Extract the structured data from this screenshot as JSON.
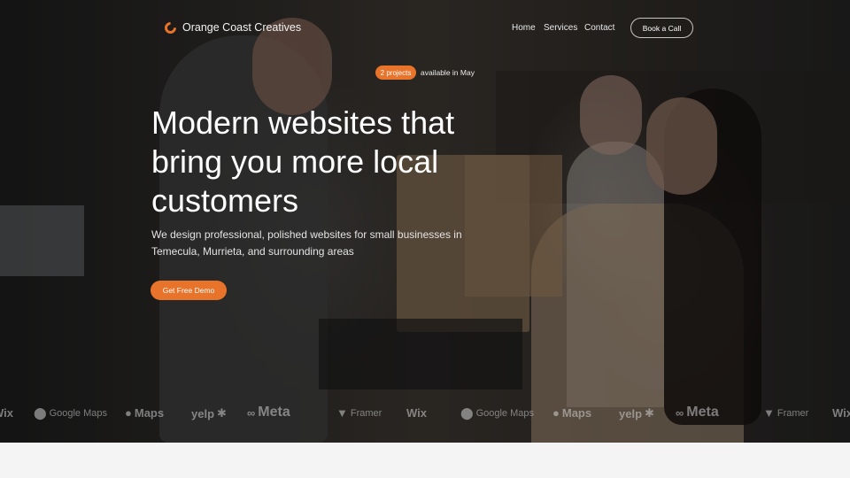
{
  "brand": {
    "name": "Orange Coast Creatives",
    "accent": "#e8732a"
  },
  "nav": {
    "items": [
      {
        "label": "Home"
      },
      {
        "label": "Services"
      },
      {
        "label": "Contact"
      }
    ],
    "cta_label": "Book a Call"
  },
  "hero": {
    "badge": "2 projects",
    "badge_text": "available in May",
    "headline": "Modern websites that bring you more local customers",
    "subtext": "We design professional, polished websites for small businesses in Temecula, Murrieta, and surrounding areas",
    "cta_label": "Get Free Demo"
  },
  "logos": {
    "items": [
      {
        "label": "Wix",
        "icon": "wix-logo"
      },
      {
        "label": "Google Maps",
        "icon": "map-pin-icon"
      },
      {
        "label": "Maps",
        "icon": "apple-icon"
      },
      {
        "label": "yelp",
        "icon": "yelp-burst-icon"
      },
      {
        "label": "Meta",
        "icon": "meta-infinity-icon"
      },
      {
        "label": "Framer",
        "icon": "framer-icon"
      }
    ]
  }
}
